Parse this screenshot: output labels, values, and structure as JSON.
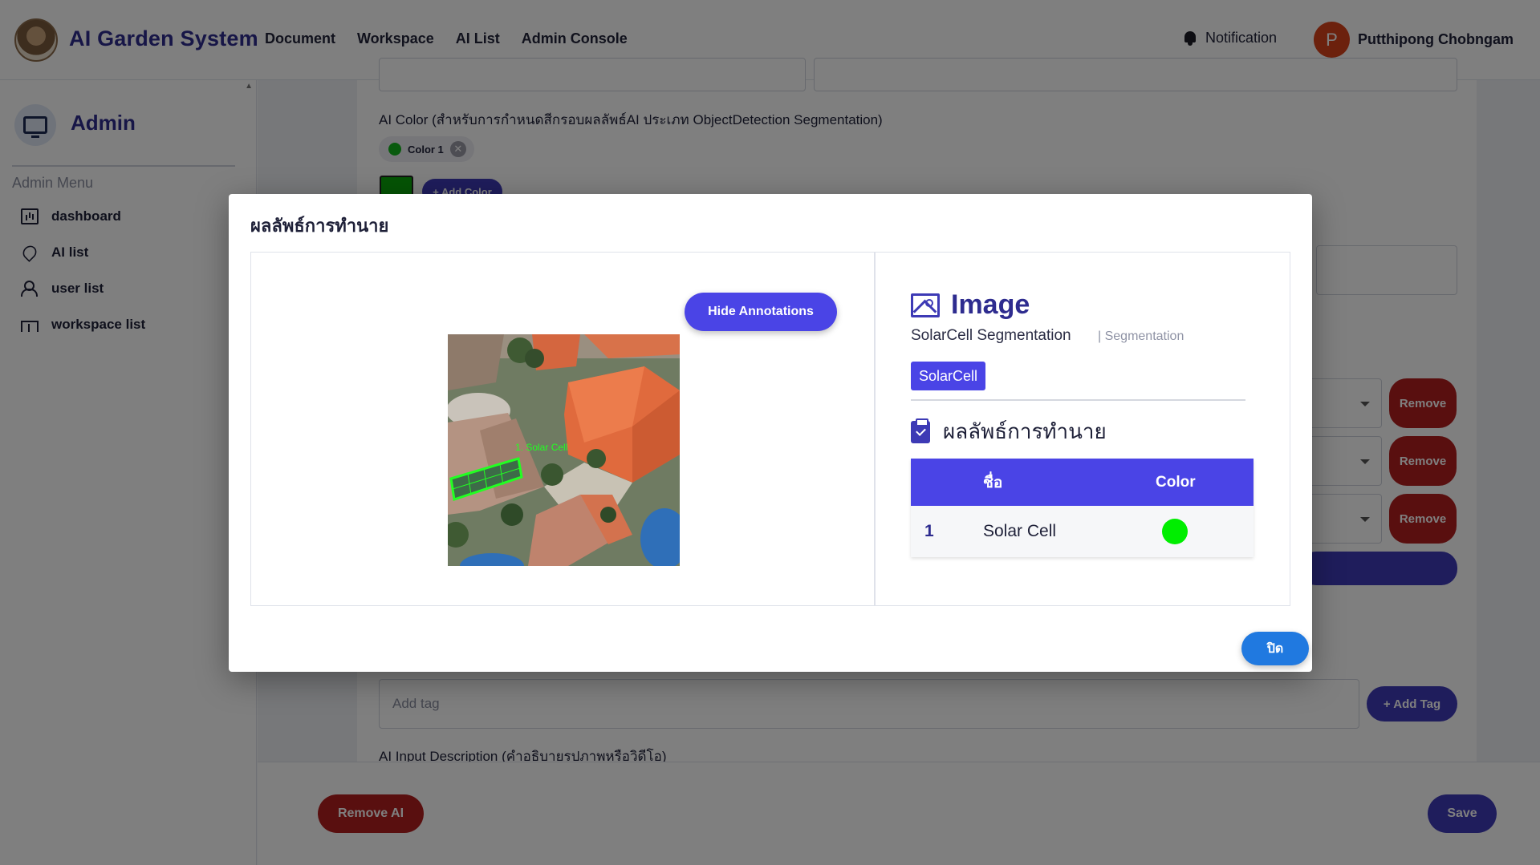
{
  "topbar": {
    "app_title": "AI Garden System",
    "nav": [
      "Document",
      "Workspace",
      "AI List",
      "Admin Console"
    ],
    "notification_label": "Notification",
    "user_initial": "P",
    "user_name": "Putthipong Chobngam"
  },
  "sidebar": {
    "title": "Admin",
    "menu_label": "Admin Menu",
    "items": [
      {
        "label": "dashboard",
        "icon": "dashboard-icon"
      },
      {
        "label": "AI list",
        "icon": "location-pin-icon"
      },
      {
        "label": "user list",
        "icon": "users-icon"
      },
      {
        "label": "workspace list",
        "icon": "workspace-icon"
      }
    ]
  },
  "form": {
    "ai_color_label": "AI Color (สำหรับการกำหนดสีกรอบผลลัพธ์AI ประเภท ObjectDetection Segmentation)",
    "color_chip_label": "Color 1",
    "add_color_label": "+ Add Color",
    "remove_label": "Remove",
    "add_tag_placeholder": "Add tag",
    "add_tag_button": "+ Add Tag",
    "input_description_label": "AI Input Description (คำอธิบายรูปภาพหรือวิดีโอ)",
    "remove_ai_button": "Remove AI",
    "save_button": "Save"
  },
  "modal": {
    "title": "ผลลัพธ์การทำนาย",
    "hide_annotations_button": "Hide Annotations",
    "image_title": "Image",
    "model_name": "SolarCell Segmentation",
    "model_type": "| Segmentation",
    "tag": "SolarCell",
    "prediction_title": "ผลลัพธ์การทำนาย",
    "table_headers": [
      "ชื่อ",
      "Color"
    ],
    "rows": [
      {
        "index": "1",
        "name": "Solar Cell",
        "color": "#00ee00"
      }
    ],
    "annotation_label": "1. Solar Cell",
    "close_button": "ปิด"
  },
  "colors": {
    "brand": "#2e2c8f",
    "accent": "#4a44e6",
    "danger": "#b21f1f",
    "annotation": "#22ff22"
  }
}
